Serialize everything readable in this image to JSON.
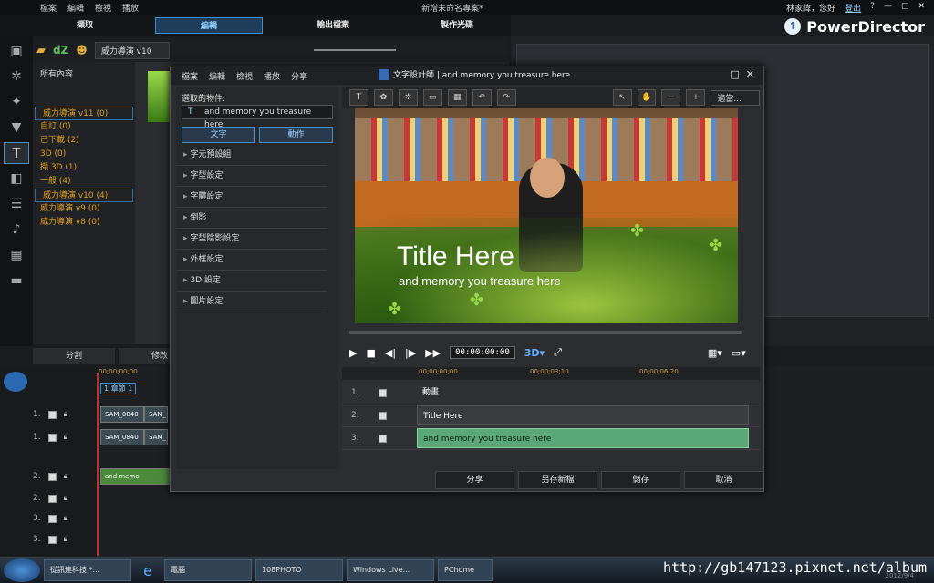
{
  "app": {
    "menu": [
      "檔案",
      "編輯",
      "檢視",
      "播放"
    ],
    "window_title": "新增未命名專案*",
    "user": "林家緯，您好",
    "login": "登出",
    "logo": "PowerDirector"
  },
  "main_tabs": [
    "擷取",
    "編輯",
    "輸出檔案",
    "製作光碟"
  ],
  "library": {
    "dropdown": "威力導演 v10",
    "root": "所有內容",
    "items": [
      {
        "label": "威力導演 v11  (0)"
      },
      {
        "label": "自訂  (0)"
      },
      {
        "label": "已下載  (2)"
      },
      {
        "label": "3D  (0)"
      },
      {
        "label": "擷 3D  (1)"
      },
      {
        "label": "一般  (4)"
      },
      {
        "label": "威力導演 v10  (4)"
      },
      {
        "label": "威力導演 v9  (0)"
      },
      {
        "label": "威力導演 v8  (0)"
      }
    ]
  },
  "bottom_tabs": [
    "分割",
    "修改"
  ],
  "timeline": {
    "ruler": [
      "00;00;00;00"
    ],
    "chapter": "1 章節 1",
    "clip_a": "SAM_0840",
    "clip_b": "SAM_",
    "title_clip": "and memo",
    "tracks": [
      "1.",
      "1.",
      "2.",
      "2.",
      "3.",
      "3."
    ]
  },
  "dialog": {
    "menu": [
      "檔案",
      "編輯",
      "檢視",
      "播放",
      "分享"
    ],
    "title": "文字設計師 | and memory you treasure here",
    "object_label": "選取的物件:",
    "object_value": "and memory you treasure here",
    "subtabs": [
      "文字",
      "動作"
    ],
    "props": [
      "字元預設組",
      "字型設定",
      "字體設定",
      "倒影",
      "字型陰影設定",
      "外框設定",
      "3D 設定",
      "圖片設定"
    ],
    "fit": "適當...",
    "preview_title": "Title Here",
    "preview_sub": "and memory you treasure here",
    "timecode": "00:00:00:00",
    "tl_ruler": [
      "00;00;00;00",
      "00;00;03;10",
      "00;00;06;20"
    ],
    "tl_rows": [
      {
        "num": "1.",
        "label": "動畫"
      },
      {
        "num": "2.",
        "label": "Title Here"
      },
      {
        "num": "3.",
        "label": "and memory you treasure here"
      }
    ],
    "buttons": [
      "分享",
      "另存新檔",
      "儲存",
      "取消"
    ]
  },
  "taskbar": [
    "從訊連科技 *...",
    "電腦",
    "108PHOTO",
    "Windows Live...",
    "PChome"
  ],
  "watermark": "http://gb147123.pixnet.net/album",
  "date": "2012/9/4"
}
